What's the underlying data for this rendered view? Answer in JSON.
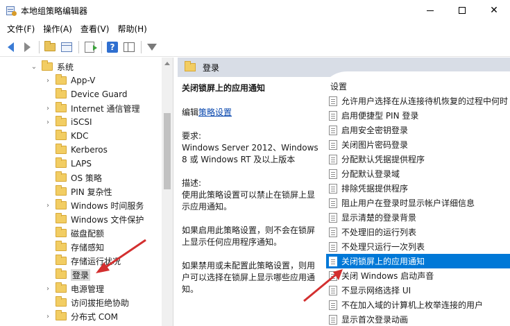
{
  "window": {
    "title": "本地组策略编辑器"
  },
  "menu": [
    "文件(F)",
    "操作(A)",
    "查看(V)",
    "帮助(H)"
  ],
  "tree": {
    "root_label": "系统",
    "items": [
      {
        "label": "App-V",
        "expandable": true
      },
      {
        "label": "Device Guard",
        "expandable": false
      },
      {
        "label": "Internet 通信管理",
        "expandable": true
      },
      {
        "label": "iSCSI",
        "expandable": true
      },
      {
        "label": "KDC",
        "expandable": false
      },
      {
        "label": "Kerberos",
        "expandable": false
      },
      {
        "label": "LAPS",
        "expandable": false
      },
      {
        "label": "OS 策略",
        "expandable": false
      },
      {
        "label": "PIN 复杂性",
        "expandable": false
      },
      {
        "label": "Windows 时间服务",
        "expandable": true
      },
      {
        "label": "Windows 文件保护",
        "expandable": false
      },
      {
        "label": "磁盘配额",
        "expandable": false
      },
      {
        "label": "存储感知",
        "expandable": false
      },
      {
        "label": "存储运行状况",
        "expandable": false
      },
      {
        "label": "登录",
        "expandable": false,
        "selected": true
      },
      {
        "label": "电源管理",
        "expandable": true
      },
      {
        "label": "访问拔拒绝协助",
        "expandable": false
      },
      {
        "label": "分布式 COM",
        "expandable": true
      }
    ]
  },
  "right": {
    "header_title": "登录",
    "desc": {
      "title": "关闭锁屏上的应用通知",
      "edit_prefix": "编辑",
      "edit_link": "策略设置",
      "req_label": "要求:",
      "req_text": "Windows Server 2012、Windows 8 或 Windows RT 及以上版本",
      "desc_label": "描述:",
      "desc_text": "使用此策略设置可以禁止在锁屏上显示应用通知。",
      "enabled_text": "如果启用此策略设置，则不会在锁屏上显示任何应用程序通知。",
      "disabled_text": "如果禁用或未配置此策略设置，则用户可以选择在锁屏上显示哪些应用通知。"
    },
    "list_header": "设置",
    "list": [
      "允许用户选择在从连接待机恢复的过程中何时",
      "启用便捷型 PIN 登录",
      "启用安全密钥登录",
      "关闭图片密码登录",
      "分配默认凭据提供程序",
      "分配默认登录域",
      "排除凭据提供程序",
      "阻止用户在登录时显示帐户详细信息",
      "显示清楚的登录背景",
      "不处理旧的运行列表",
      "不处理只运行一次列表",
      "关闭锁屏上的应用通知",
      "关闭 Windows 启动声音",
      "不显示网络选择 UI",
      "不在加入域的计算机上枚举连接的用户",
      "显示首次登录动画"
    ],
    "selected_index": 11
  },
  "colors": {
    "selection": "#0078d7",
    "annotation_arrow": "#d32f2f",
    "header_bg": "#d8dde6"
  }
}
